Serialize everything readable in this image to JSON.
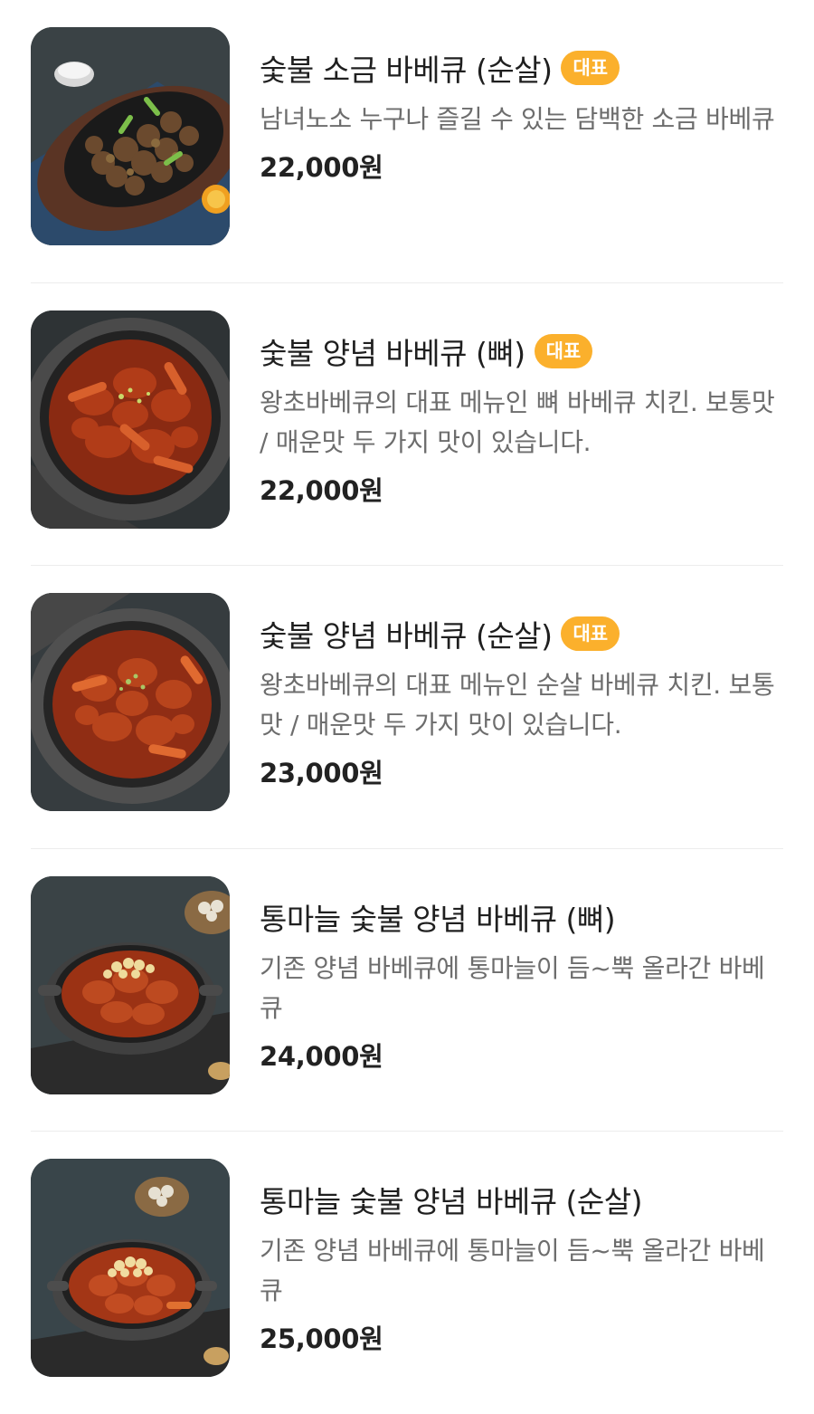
{
  "menu": {
    "badge_label": "대표",
    "items": [
      {
        "title": "숯불 소금 바베큐 (순살)",
        "has_badge": true,
        "badge": "대표",
        "description": "남녀노소 누구나 즐길 수 있는 담백한 소금 바베큐",
        "price": "22,000원",
        "image": "salt-bbq-sizzling-plate"
      },
      {
        "title": "숯불 양념 바베큐 (뼈)",
        "has_badge": true,
        "badge": "대표",
        "description": "왕초바베큐의 대표 메뉴인 뼈 바베큐 치킨. 보통맛 / 매운맛 두 가지 맛이 있습니다.",
        "price": "22,000원",
        "image": "spicy-bbq-stone-bowl"
      },
      {
        "title": "숯불 양념 바베큐 (순살)",
        "has_badge": true,
        "badge": "대표",
        "description": "왕초바베큐의 대표 메뉴인 순살 바베큐 치킨. 보통맛 / 매운맛 두 가지 맛이 있습니다.",
        "price": "23,000원",
        "image": "spicy-boneless-bbq-stone-bowl"
      },
      {
        "title": "통마늘 숯불 양념 바베큐 (뼈)",
        "has_badge": false,
        "badge": "",
        "description": "기존 양념 바베큐에 통마늘이 듬~뿍 올라간 바베큐",
        "price": "24,000원",
        "image": "garlic-bbq-pan"
      },
      {
        "title": "통마늘 숯불 양념 바베큐 (순살)",
        "has_badge": false,
        "badge": "",
        "description": "기존 양념 바베큐에 통마늘이 듬~뿍 올라간 바베큐",
        "price": "25,000원",
        "image": "garlic-boneless-bbq-pan"
      }
    ]
  }
}
